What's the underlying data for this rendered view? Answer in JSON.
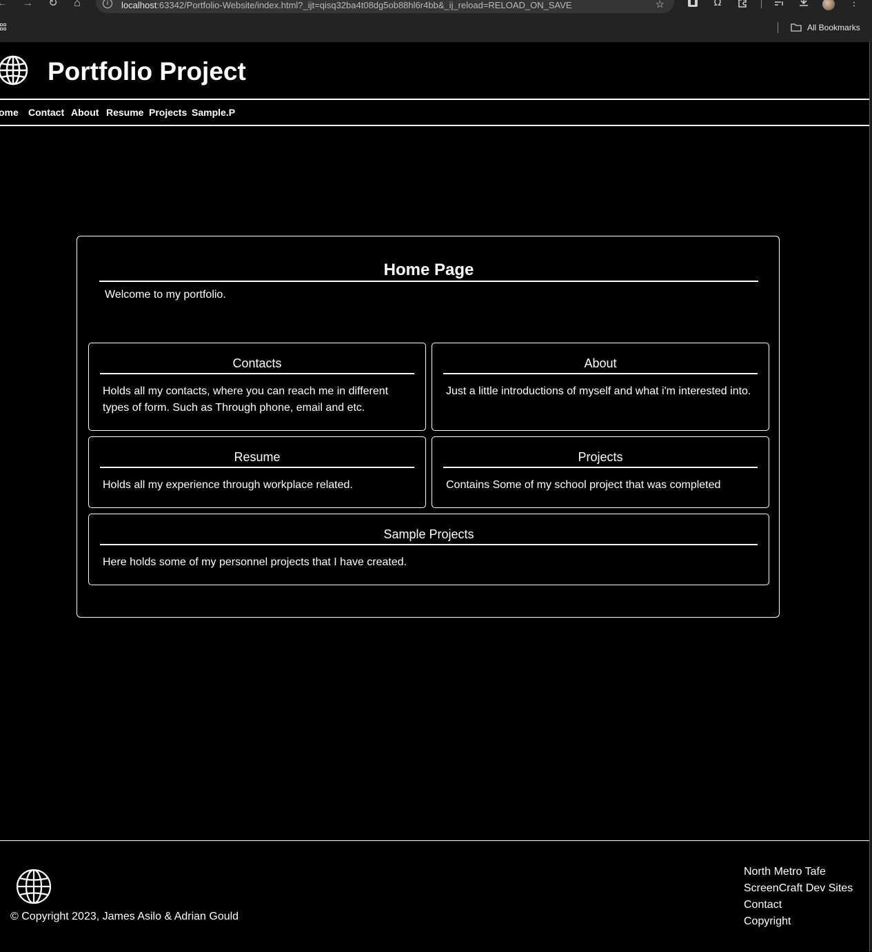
{
  "browser": {
    "url_host": "localhost",
    "url_rest": ":63342/Portfolio-Website/index.html?_ijt=qisq32ba4t08dg5ob88hl6r4bb&_ij_reload=RELOAD_ON_SAVE",
    "bookmarks_label": "All Bookmarks",
    "icons": [
      "back-icon",
      "forward-icon",
      "reload-icon",
      "home-icon",
      "info-icon",
      "star-icon",
      "extension-icon",
      "omega-icon",
      "puzzle-icon",
      "media-icon",
      "download-icon",
      "profile-avatar",
      "menu-icon",
      "apps-icon",
      "folder-icon"
    ]
  },
  "header": {
    "title": "Portfolio Project",
    "logo_icon": "globe-icon"
  },
  "nav": {
    "items": [
      "ome",
      "Contact",
      "About",
      "Resume",
      "Projects",
      "Sample.P"
    ]
  },
  "main": {
    "heading": "Home Page",
    "welcome": "Welcome to my portfolio.",
    "cards": [
      {
        "title": "Contacts",
        "text": "Holds all my contacts, where you can reach me in different types of form. Such as Through phone, email and etc."
      },
      {
        "title": "About",
        "text": "Just a little introductions of myself and what i'm interested into."
      },
      {
        "title": "Resume",
        "text": "Holds all my experience through workplace related."
      },
      {
        "title": "Projects",
        "text": "Contains Some of my school project that was completed"
      },
      {
        "title": "Sample Projects",
        "text": "Here holds some of my personnel projects that I have created."
      }
    ]
  },
  "footer": {
    "copyright": "© Copyright 2023, James Asilo & Adrian Gould",
    "links": [
      "North Metro Tafe",
      "ScreenCraft Dev Sites",
      "Contact",
      "Copyright"
    ],
    "logo_icon": "globe-icon"
  },
  "colors": {
    "background": "#000000",
    "text": "#ffffff",
    "chrome": "#232323",
    "urlbar": "#353535"
  }
}
